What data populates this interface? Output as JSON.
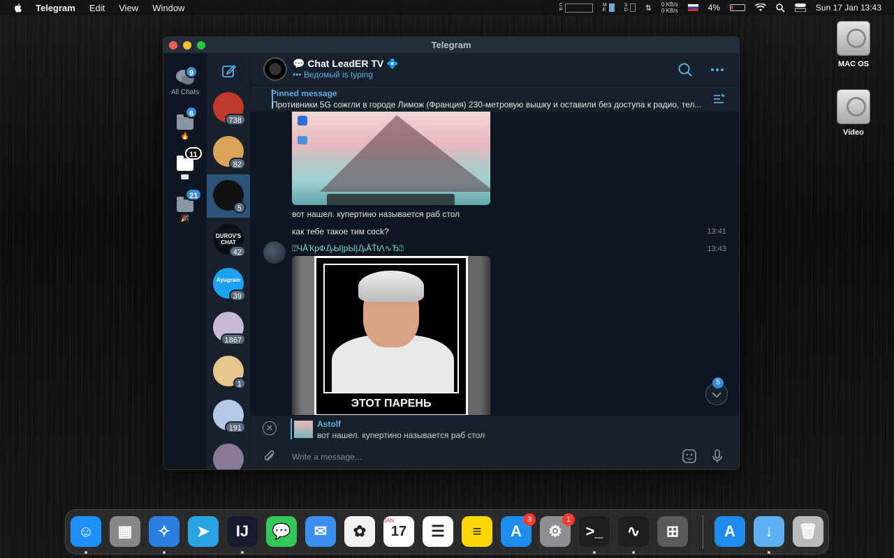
{
  "menubar": {
    "app_name": "Telegram",
    "menus": [
      "Edit",
      "View",
      "Window"
    ],
    "net_up": "0 KB/s",
    "net_down": "0 KB/s",
    "battery": "4%",
    "datetime": "Sun 17 Jan  13:43"
  },
  "desktop": {
    "icons": [
      {
        "label": "MAC OS"
      },
      {
        "label": "Video"
      }
    ]
  },
  "window": {
    "title": "Telegram"
  },
  "folders": [
    {
      "label": "All Chats",
      "badge": "9"
    },
    {
      "label": "🔥",
      "badge": "6"
    },
    {
      "label": "✉️",
      "badge": "11"
    },
    {
      "label": "🎉",
      "badge": "21"
    }
  ],
  "chats": [
    {
      "count": "738",
      "color": "#c0392b"
    },
    {
      "count": "82",
      "color": "#d9a35a"
    },
    {
      "count": "5",
      "color": "#111111"
    },
    {
      "count": "42",
      "color": "#0b1018",
      "text": "DUROV'S CHAT"
    },
    {
      "count": "39",
      "color": "#1da1f2",
      "text": "Ayugram"
    },
    {
      "count": "1867",
      "color": "#c9b9d8"
    },
    {
      "count": "1",
      "color": "#e8c58b"
    },
    {
      "count": "191",
      "color": "#b7c9e8"
    },
    {
      "count": "",
      "color": "#8a7a9a"
    }
  ],
  "header": {
    "title": "💬 Chat LeadER TV 💠",
    "status": "••• Ведомый is typing"
  },
  "pinned": {
    "label": "Pinned message",
    "text": "Противники 5G сожгли в городе Лимож (Франция) 230-метровую вышку и оставили без доступа к радио, тел..."
  },
  "messages": [
    {
      "text": "вот нашел. купертино называется раб стол"
    },
    {
      "text": "как тебе такое тим cock?",
      "time": "13:41"
    },
    {
      "sender": "⍰ЧÅҠрФ₯Ы|рЫ|₯ÅŤŧΛ∿Ђ⍰",
      "time": "13:43",
      "sticker_caption": "ЭТОТ ПАРЕНЬ"
    }
  ],
  "scroll_badge": "5",
  "reply": {
    "name": "Astolf",
    "text": "вот нашел. купертино называется раб стол"
  },
  "composer": {
    "placeholder": "Write a message..."
  },
  "dock": {
    "apps": [
      {
        "name": "Finder",
        "color": "#1e90ff",
        "glyph": "☺"
      },
      {
        "name": "Launchpad",
        "color": "#888888",
        "glyph": "▦"
      },
      {
        "name": "Safari",
        "color": "#2a7de1",
        "glyph": "✧"
      },
      {
        "name": "Telegram",
        "color": "#2aa3e3",
        "glyph": "➤"
      },
      {
        "name": "IntelliJ IDEA",
        "color": "#1a1a2e",
        "glyph": "IJ"
      },
      {
        "name": "Messages",
        "color": "#34c759",
        "glyph": "💬"
      },
      {
        "name": "Mail",
        "color": "#3b8ff0",
        "glyph": "✉"
      },
      {
        "name": "Photos",
        "color": "#f2f2f2",
        "glyph": "✿"
      },
      {
        "name": "Calendar",
        "color": "#ffffff",
        "glyph": "17",
        "month": "JAN"
      },
      {
        "name": "Reminders",
        "color": "#ffffff",
        "glyph": "☰"
      },
      {
        "name": "Notes",
        "color": "#ffd60a",
        "glyph": "≡"
      },
      {
        "name": "App Store",
        "color": "#1c8cf0",
        "glyph": "A",
        "badge": "3"
      },
      {
        "name": "System Preferences",
        "color": "#8e8e93",
        "glyph": "⚙",
        "badge": "1"
      },
      {
        "name": "Terminal",
        "color": "#1e1e1e",
        "glyph": ">_"
      },
      {
        "name": "Activity Monitor",
        "color": "#1e1e1e",
        "glyph": "∿"
      },
      {
        "name": "Calculator",
        "color": "#5a5a5a",
        "glyph": "⊞"
      },
      {
        "name": "Applications",
        "color": "#1c8cf0",
        "glyph": "A"
      },
      {
        "name": "Downloads",
        "color": "#5ab0f0",
        "glyph": "↓"
      },
      {
        "name": "Trash",
        "color": "#bbbbbb",
        "glyph": "🗑"
      }
    ]
  }
}
